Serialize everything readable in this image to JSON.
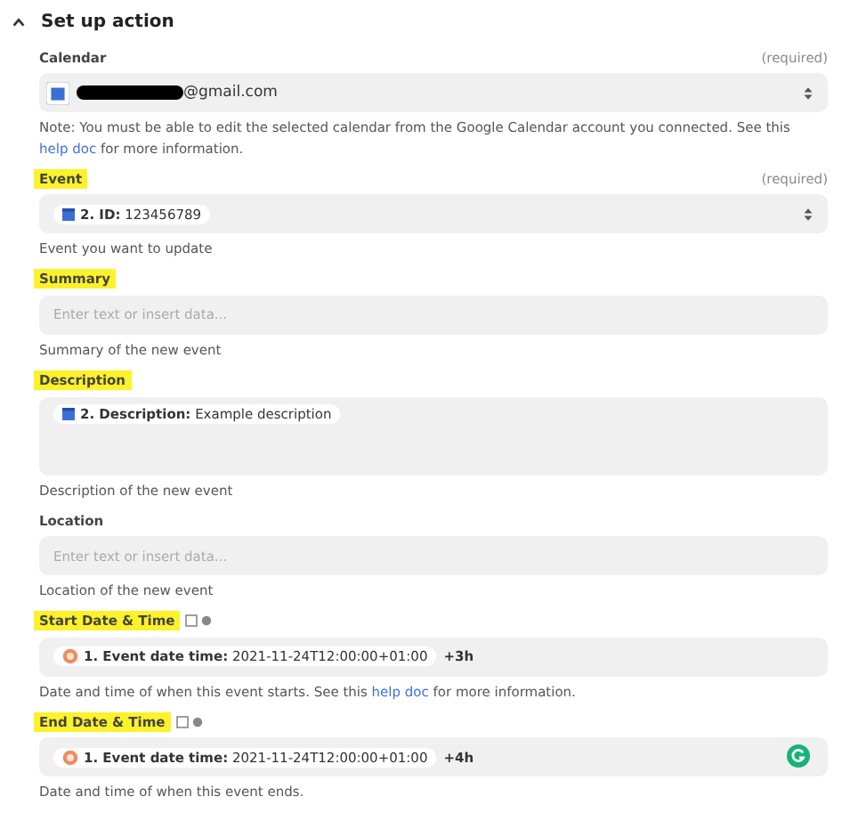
{
  "section": {
    "title": "Set up action",
    "expanded": true
  },
  "fields": [
    {
      "kind": "select",
      "label": "Calendar",
      "required": "(required)",
      "highlighted": false,
      "value": {
        "redacted": true,
        "text": "@gmail.com"
      },
      "help": {
        "before": "Note: You must be able to edit the selected calendar from the Google Calendar account you connected. See this ",
        "link": "help doc",
        "after": " for more information."
      }
    },
    {
      "kind": "select",
      "label": "Event",
      "required": "(required)",
      "highlighted": true,
      "pills": [
        {
          "kind": "action_step",
          "text": "**2. ID:** 123456789"
        }
      ],
      "help": {
        "before": "Event you want to update"
      }
    },
    {
      "kind": "text",
      "label": "Summary",
      "highlighted": true,
      "placeholder": "Enter text or insert data...",
      "help": {
        "before": "Summary of the new event"
      }
    },
    {
      "kind": "textarea",
      "label": "Description",
      "highlighted": true,
      "pills": [
        {
          "kind": "action_step",
          "text": "**2. Description:** Example description"
        }
      ],
      "help": {
        "before": "Description of the new event"
      }
    },
    {
      "kind": "text",
      "label": "Location",
      "highlighted": false,
      "placeholder": "Enter text or insert data...",
      "help": {
        "before": "Location of the new event"
      }
    },
    {
      "kind": "text",
      "label": "Start Date & Time",
      "highlighted": true,
      "label_icons": true,
      "pills": [
        {
          "kind": "trigger_step",
          "text": "**1. Event date time:** 2021-11-24T12:00:00+01:00"
        }
      ],
      "suffix": "+3h",
      "help": {
        "before": "Date and time of when this event starts. See this ",
        "link": "help doc",
        "after": " for more information."
      }
    },
    {
      "kind": "text",
      "label": "End Date & Time",
      "highlighted": true,
      "label_icons": true,
      "assistant_badge": true,
      "pills": [
        {
          "kind": "trigger_step",
          "text": "**1. Event date time:** 2021-11-24T12:00:00+01:00"
        }
      ],
      "suffix": "+4h",
      "help": {
        "before": "Date and time of when this event ends."
      }
    }
  ]
}
